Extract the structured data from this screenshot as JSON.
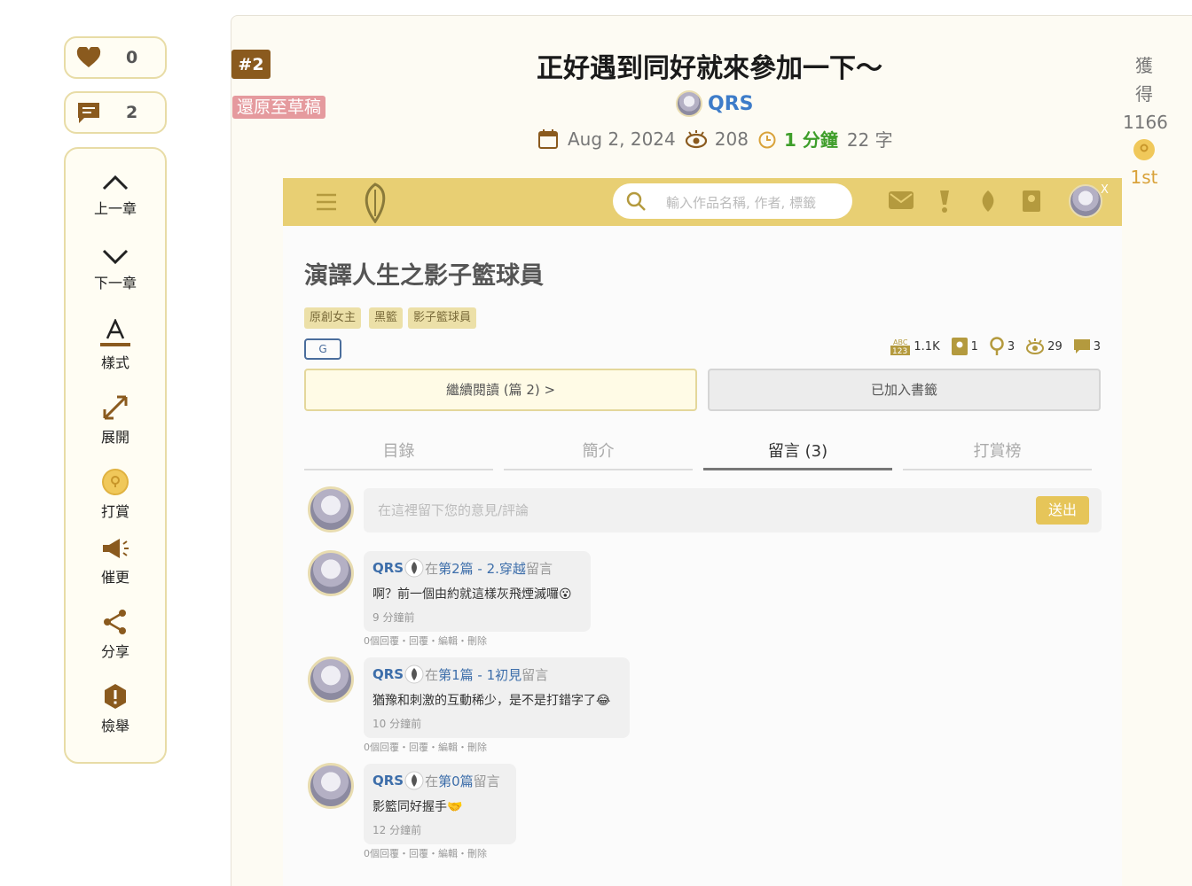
{
  "sidebar": {
    "likes": "0",
    "comments": "2",
    "items": [
      {
        "label": "上一章",
        "icon": "chevron-up-icon"
      },
      {
        "label": "下一章",
        "icon": "chevron-down-icon"
      },
      {
        "label": "樣式",
        "icon": "text-style-icon"
      },
      {
        "label": "展開",
        "icon": "expand-icon"
      },
      {
        "label": "打賞",
        "icon": "coin-icon"
      },
      {
        "label": "催更",
        "icon": "megaphone-icon"
      },
      {
        "label": "分享",
        "icon": "share-icon"
      },
      {
        "label": "檢舉",
        "icon": "report-icon"
      }
    ]
  },
  "post": {
    "number": "#2",
    "restore_label": "還原至草稿",
    "title": "正好遇到同好就來參加一下～",
    "author": "QRS",
    "date": "Aug 2, 2024",
    "views": "208",
    "read_time": "1 分鐘",
    "words": "22 字",
    "award_label": "獲得",
    "award_points": "1166",
    "award_rank": "1st"
  },
  "shot": {
    "search_placeholder": "輸入作品名稱, 作者, 標籤",
    "close_label": "X",
    "book_title": "演譯人生之影子籃球員",
    "tags": [
      "原創女主",
      "黑籃",
      "影子籃球員"
    ],
    "rating": "G",
    "stats": {
      "words": "1.1K",
      "bookmarks": "1",
      "likes": "3",
      "views": "29",
      "comments": "3"
    },
    "continue_label": "繼續閱讀 (篇 2) >",
    "shelf_label": "已加入書籤",
    "tabs": [
      "目錄",
      "簡介",
      "留言 (3)",
      "打賞榜"
    ],
    "comment_placeholder": "在這裡留下您的意見/評論",
    "send_label": "送出",
    "comments": [
      {
        "user": "QRS",
        "at": "在",
        "chapter": "第2篇 - 2.穿越",
        "suffix": "留言",
        "body": "啊？前一個由約就這樣灰飛煙滅囉😮",
        "time": "9 分鐘前",
        "actions": "0個回覆・回覆・編輯・刪除"
      },
      {
        "user": "QRS",
        "at": "在",
        "chapter": "第1篇 - 1初見",
        "suffix": "留言",
        "body": "猶豫和刺激的互動稀少，是不是打錯字了😂",
        "time": "10 分鐘前",
        "actions": "0個回覆・回覆・編輯・刪除"
      },
      {
        "user": "QRS",
        "at": "在",
        "chapter": "第0篇",
        "suffix": "留言",
        "body": "影籃同好握手🤝",
        "time": "12 分鐘前",
        "actions": "0個回覆・回覆・編輯・刪除"
      }
    ]
  },
  "colors": {
    "accent": "#e8cf73",
    "brown": "#8a5a1e",
    "link": "#3d7cc9",
    "green": "#3e9e2a"
  }
}
